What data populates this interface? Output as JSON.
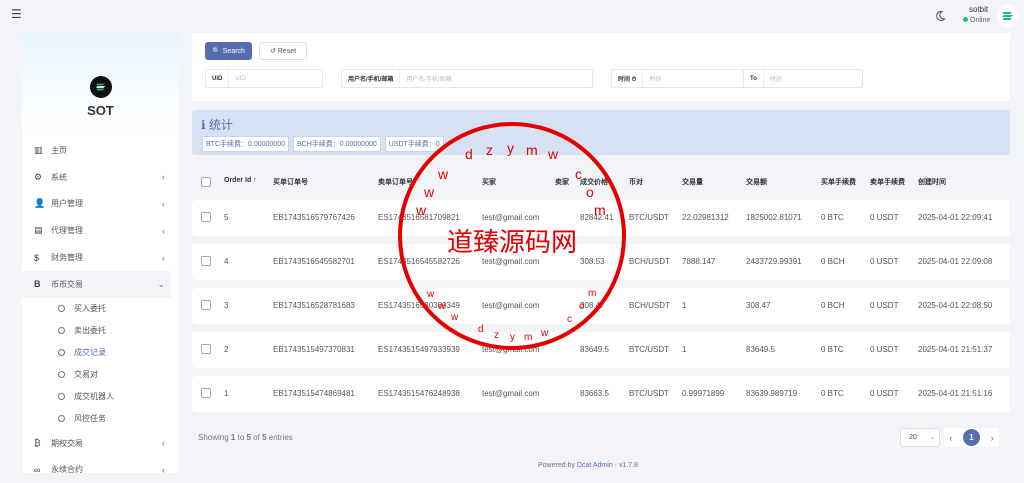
{
  "topbar": {
    "menu_icon": "hamburger-icon",
    "user_name": "sotbit",
    "user_status": "Online"
  },
  "sidebar": {
    "brand": "SOT",
    "items": [
      {
        "label": "主页",
        "icon": "chart-icon"
      },
      {
        "label": "系统",
        "icon": "gear-icon"
      },
      {
        "label": "用户管理",
        "icon": "users-icon"
      },
      {
        "label": "代理管理",
        "icon": "idcard-icon"
      },
      {
        "label": "财务管理",
        "icon": "dollar-icon"
      },
      {
        "label": "币币交易",
        "icon": "bitcoin-icon"
      }
    ],
    "subitems": [
      "买入委托",
      "卖出委托",
      "成交记录",
      "交易对",
      "成交机器人",
      "风控任务"
    ],
    "items_after": [
      {
        "label": "期权交易",
        "icon": "bitcoin-icon"
      },
      {
        "label": "永续合约",
        "icon": "link-icon"
      }
    ]
  },
  "filter": {
    "search_label": "Search",
    "reset_label": "Reset",
    "uid_label": "UID",
    "uid_placeholder": "UID",
    "user_label": "用户名/手机/邮箱",
    "user_placeholder": "用户名/手机/邮箱",
    "time_label": "时间 ⏱",
    "time_start": "时间",
    "to_label": "To",
    "time_end": "时间"
  },
  "stats": {
    "title": "统计",
    "tags": [
      "BTC手续费：0.00000000",
      "BCH手续费：0.00000000",
      "USDT手续费：0"
    ]
  },
  "table": {
    "headers": [
      "Order Id ↑",
      "买单订单号",
      "卖单订单号",
      "买家",
      "卖家",
      "成交价格",
      "币对",
      "交易量",
      "交易额",
      "买单手续费",
      "卖单手续费",
      "创建时间"
    ],
    "rows": [
      [
        "5",
        "EB1743516579767426",
        "ES1743516581709821",
        "test@gmail.com",
        "",
        "82842.41",
        "BTC/USDT",
        "22.02981312",
        "1825002.81071",
        "0 BTC",
        "0 USDT",
        "2025-04-01 22:09:41"
      ],
      [
        "4",
        "EB1743516545582701",
        "ES1743516545582726",
        "test@gmail.com",
        "",
        "308.53",
        "BCH/USDT",
        "7888.147",
        "2433729.99391",
        "0 BCH",
        "0 USDT",
        "2025-04-01 22:09:08"
      ],
      [
        "3",
        "EB1743516528781683",
        "ES1743516530389349",
        "test@gmail.com",
        "",
        "308.47",
        "BCH/USDT",
        "1",
        "308.47",
        "0 BCH",
        "0 USDT",
        "2025-04-01 22:08:50"
      ],
      [
        "2",
        "EB1743515497370831",
        "ES1743515497933939",
        "test@gmail.com",
        "",
        "83649.5",
        "BTC/USDT",
        "1",
        "83649.5",
        "0 BTC",
        "0 USDT",
        "2025-04-01 21:51:37"
      ],
      [
        "1",
        "EB1743515474869481",
        "ES1743515476248938",
        "test@gmail.com",
        "",
        "83663.5",
        "BTC/USDT",
        "0.99971899",
        "83639.989719",
        "0 BTC",
        "0 USDT",
        "2025-04-01 21:51:16"
      ]
    ]
  },
  "pagination": {
    "info_prefix": "Showing ",
    "from": "1",
    "to_word": " to ",
    "to": "5",
    "of_word": " of ",
    "total": "5",
    "entries": " entries",
    "per_page": "20",
    "page": "1"
  },
  "footer": {
    "powered_by": "Powered by ",
    "link": "Dcat Admin",
    "version": " · v1.7.8"
  },
  "watermark": {
    "text": "道臻源码网",
    "url": "w w w . d z y m w . c o m"
  },
  "colors": {
    "primary": "#586cb1",
    "seal": "#e40000",
    "online": "#21b978"
  }
}
